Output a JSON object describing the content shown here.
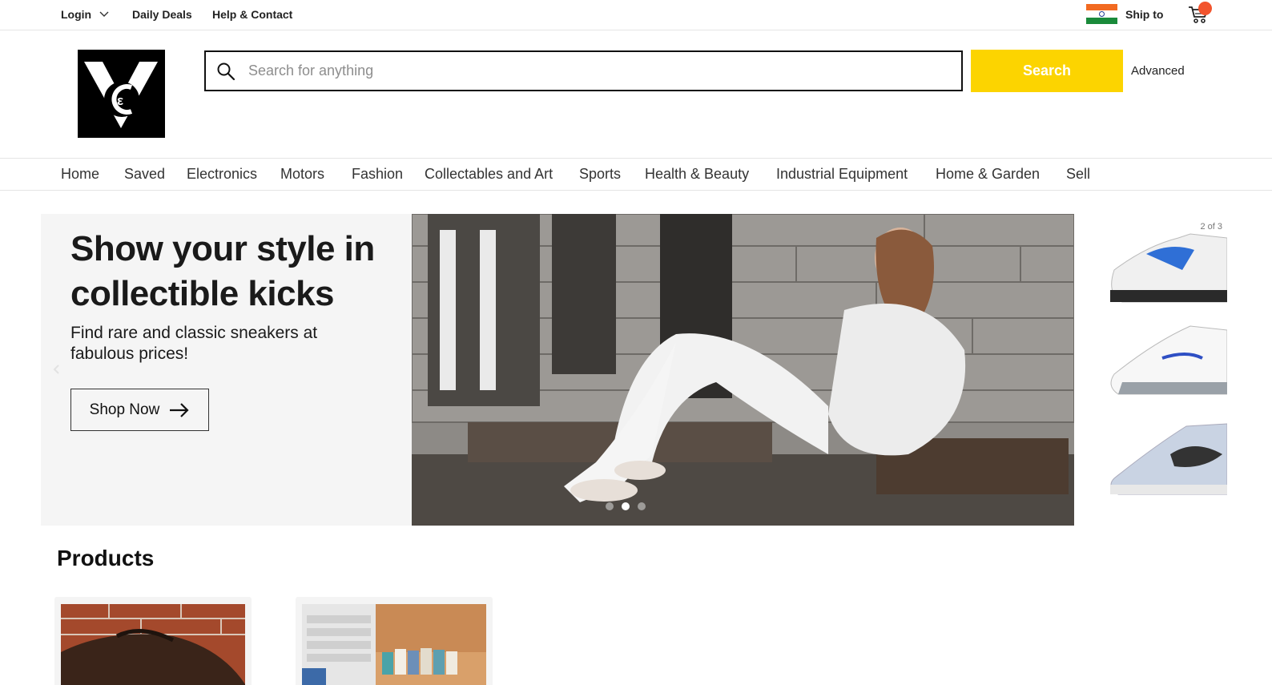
{
  "topbar": {
    "login": "Login",
    "daily_deals": "Daily Deals",
    "help": "Help & Contact",
    "ship_to": "Ship to"
  },
  "search": {
    "placeholder": "Search for anything",
    "value": "",
    "button": "Search",
    "advanced": "Advanced"
  },
  "categories": [
    "Home",
    "Saved",
    "Electronics",
    "Motors",
    "Fashion",
    "Collectables and Art",
    "Sports",
    "Health & Beauty",
    "Industrial Equipment",
    "Home & Garden",
    "Sell"
  ],
  "hero": {
    "title": "Show your style in collectible kicks",
    "subtitle": "Find rare and classic sneakers at fabulous prices!",
    "cta": "Shop Now",
    "counter": "2 of 3",
    "active_slide": 1,
    "slide_count": 3
  },
  "products": {
    "title": "Products"
  },
  "colors": {
    "search_button": "#fcd400",
    "cart_badge": "#f2542d",
    "hero_bg": "#f5f5f5"
  },
  "icons": [
    "chevron-down-icon",
    "india-flag-icon",
    "cart-icon",
    "search-icon",
    "arrow-right-icon"
  ]
}
